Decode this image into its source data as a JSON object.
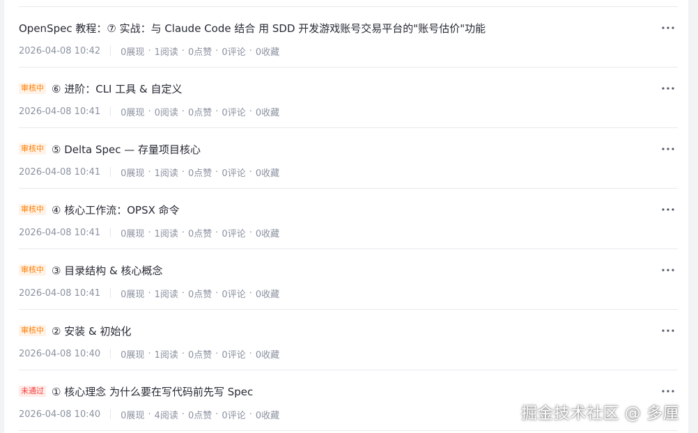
{
  "articles": [
    {
      "badge": "",
      "title": "OpenSpec 教程：⑦ 实战：与 Claude Code 结合 用 SDD 开发游戏账号交易平台的\"账号估价\"功能",
      "date": "2026-04-08 10:42",
      "views": "0展现",
      "reads": "1阅读",
      "likes": "0点赞",
      "comments": "0评论",
      "favorites": "0收藏"
    },
    {
      "badge": "审核中",
      "title": "⑥ 进阶：CLI 工具 & 自定义",
      "date": "2026-04-08 10:41",
      "views": "0展现",
      "reads": "0阅读",
      "likes": "0点赞",
      "comments": "0评论",
      "favorites": "0收藏"
    },
    {
      "badge": "审核中",
      "title": "⑤ Delta Spec — 存量项目核心",
      "date": "2026-04-08 10:41",
      "views": "0展现",
      "reads": "1阅读",
      "likes": "0点赞",
      "comments": "0评论",
      "favorites": "0收藏"
    },
    {
      "badge": "审核中",
      "title": "④ 核心工作流：OPSX 命令",
      "date": "2026-04-08 10:41",
      "views": "0展现",
      "reads": "1阅读",
      "likes": "0点赞",
      "comments": "0评论",
      "favorites": "0收藏"
    },
    {
      "badge": "审核中",
      "title": "③ 目录结构 & 核心概念",
      "date": "2026-04-08 10:41",
      "views": "0展现",
      "reads": "1阅读",
      "likes": "0点赞",
      "comments": "0评论",
      "favorites": "0收藏"
    },
    {
      "badge": "审核中",
      "title": "② 安装 & 初始化",
      "date": "2026-04-08 10:40",
      "views": "0展现",
      "reads": "1阅读",
      "likes": "0点赞",
      "comments": "0评论",
      "favorites": "0收藏"
    },
    {
      "badge": "未通过",
      "title": "① 核心理念 为什么要在写代码前先写 Spec",
      "date": "2026-04-08 10:40",
      "views": "0展现",
      "reads": "4阅读",
      "likes": "0点赞",
      "comments": "0评论",
      "favorites": "0收藏"
    }
  ],
  "icons": {
    "more": "more-horizontal-icon"
  },
  "colors": {
    "review_badge": "#ff7d00",
    "rejected_badge": "#f53f3f",
    "title_text": "#252933",
    "meta_text": "#8a919f"
  },
  "watermark": "掘金技术社区 @ 多厘"
}
